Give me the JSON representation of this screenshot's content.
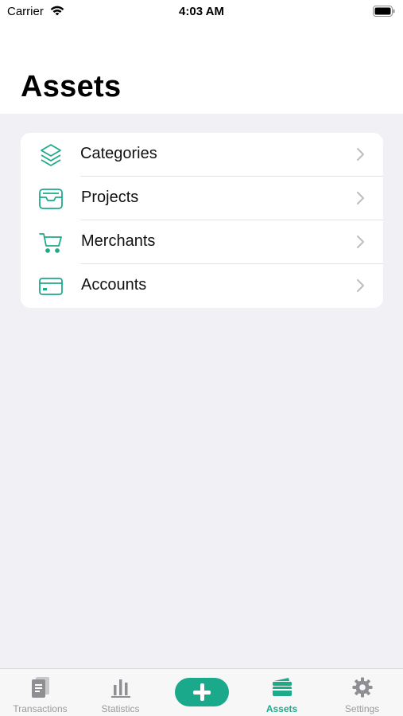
{
  "status_bar": {
    "carrier": "Carrier",
    "time": "4:03 AM"
  },
  "header": {
    "title": "Assets"
  },
  "menu": {
    "items": [
      {
        "label": "Categories",
        "icon": "layers-icon"
      },
      {
        "label": "Projects",
        "icon": "inbox-tray-icon"
      },
      {
        "label": "Merchants",
        "icon": "shopping-cart-icon"
      },
      {
        "label": "Accounts",
        "icon": "credit-card-icon"
      }
    ]
  },
  "tab_bar": {
    "items": [
      {
        "label": "Transactions",
        "icon": "document-icon",
        "active": false
      },
      {
        "label": "Statistics",
        "icon": "bar-chart-icon",
        "active": false
      },
      {
        "label": "",
        "icon": "plus-icon",
        "active": false
      },
      {
        "label": "Assets",
        "icon": "cards-icon",
        "active": true
      },
      {
        "label": "Settings",
        "icon": "gear-icon",
        "active": false
      }
    ]
  },
  "colors": {
    "accent": "#1faa8a",
    "background": "#f0f0f5",
    "card": "#ffffff",
    "inactive_tab": "#9a9a9e"
  }
}
